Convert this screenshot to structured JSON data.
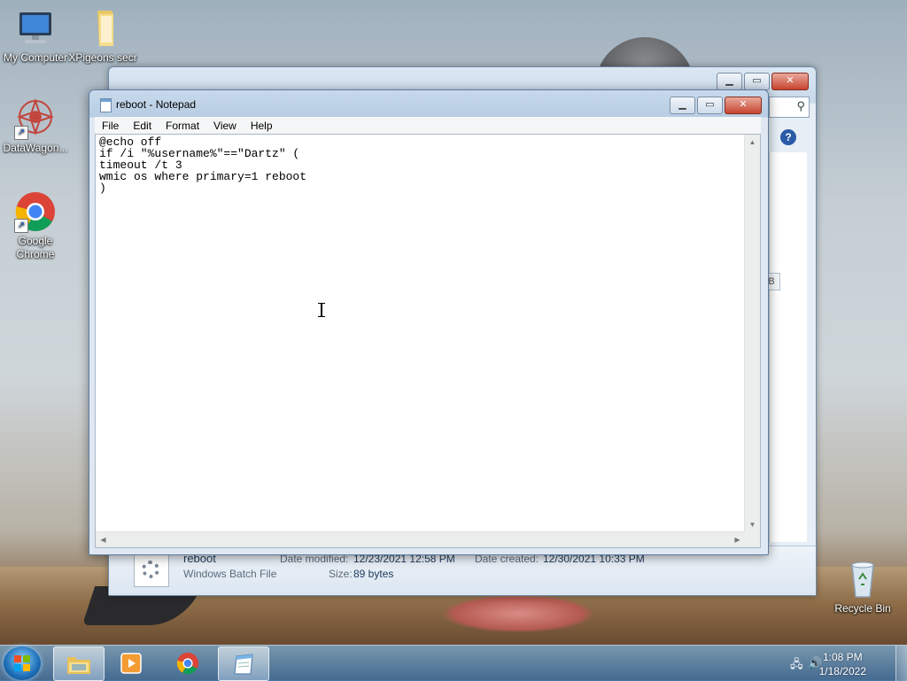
{
  "desktop": {
    "icons": [
      {
        "label": "My Computer",
        "icon": "computer-icon"
      },
      {
        "label": "XPigeons secr",
        "icon": "folder-icon"
      },
      {
        "label": "DataWagon...",
        "icon": "datawagon-icon"
      },
      {
        "label": "Google Chrome",
        "icon": "chrome-icon"
      },
      {
        "label": "Recycle Bin",
        "icon": "recycle-bin-icon"
      }
    ]
  },
  "explorer": {
    "details": {
      "file_name": "reboot",
      "file_type": "Windows Batch File",
      "modified_label": "Date modified:",
      "modified_value": "12/23/2021 12:58 PM",
      "created_label": "Date created:",
      "created_value": "12/30/2021 10:33 PM",
      "size_label": "Size:",
      "size_value": "89 bytes"
    },
    "side_letter": "B"
  },
  "notepad": {
    "title": "reboot - Notepad",
    "menu": [
      "File",
      "Edit",
      "Format",
      "View",
      "Help"
    ],
    "content": "@echo off\nif /i \"%username%\"==\"Dartz\" (\ntimeout /t 3\nwmic os where primary=1 reboot\n)"
  },
  "taskbar": {
    "apps": [
      {
        "name": "Windows Explorer",
        "icon": "explorer-icon",
        "active": false
      },
      {
        "name": "Media Player",
        "icon": "media-player-icon",
        "active": false
      },
      {
        "name": "Google Chrome",
        "icon": "chrome-icon",
        "active": false
      },
      {
        "name": "Notepad",
        "icon": "notepad-icon",
        "active": true
      }
    ],
    "clock_time": "1:08 PM",
    "clock_date": "1/18/2022"
  }
}
